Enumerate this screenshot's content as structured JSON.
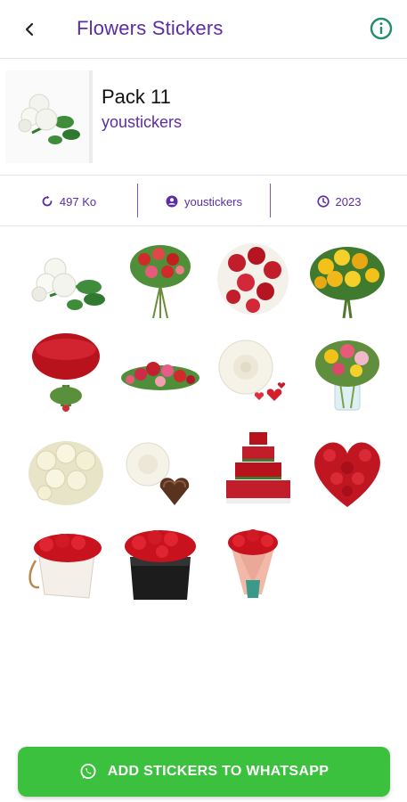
{
  "appbar": {
    "title": "Flowers Stickers",
    "back_icon": "back-arrow-icon",
    "info_icon": "info-icon"
  },
  "pack": {
    "name": "Pack 11",
    "publisher": "youstickers"
  },
  "meta": {
    "size": "497 Ko",
    "author": "youstickers",
    "year": "2023"
  },
  "stickers": [
    "white-roses",
    "mixed-bouquet",
    "red-white-roses",
    "yellow-roses",
    "red-rose-dome",
    "flower-arrangement",
    "white-rose-hearts",
    "flowers-in-vase",
    "white-roses-bunch",
    "white-rose-cake",
    "tiered-red-cake",
    "red-rose-heart",
    "rose-box-bag",
    "rose-black-box",
    "pink-wrapped-bouquet"
  ],
  "cta": {
    "label": "ADD STICKERS TO WHATSAPP"
  },
  "colors": {
    "accent": "#5b2ca6",
    "cta": "#3cc13f",
    "info": "#1f8f6a"
  }
}
